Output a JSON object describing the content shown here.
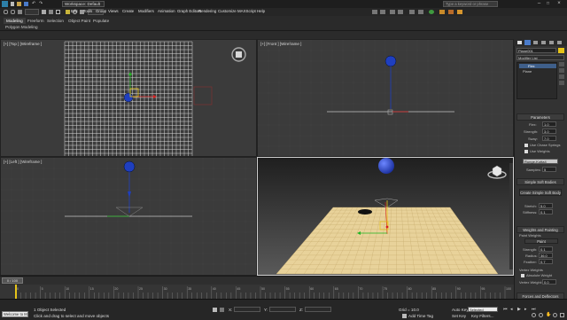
{
  "window": {
    "workspace": "Workspace: Default",
    "search_placeholder": "Type a keyword or phrase"
  },
  "menu": [
    "Edit",
    "Tools",
    "Group",
    "Views",
    "Create",
    "Modifiers",
    "Animation",
    "Graph Editors",
    "Rendering",
    "Customize",
    "MAXScript",
    "Help"
  ],
  "ribbon": {
    "tabs": [
      "Modeling",
      "Freeform",
      "Selection",
      "Object Paint",
      "Populate"
    ],
    "active_tab": "Modeling",
    "sub_label": "Polygon Modeling"
  },
  "viewports": {
    "top": "[+] [Top ] [Wireframe ]",
    "front": "[+] [Front ] [Wireframe ]",
    "left": "[+] [Left ] [Wireframe ]",
    "perspective": "[+] [Perspective ] [Realistic ]"
  },
  "command_panel": {
    "object_name": "Plane001",
    "modifier_list": "Modifier List",
    "stack": [
      "Flex",
      "Plane"
    ],
    "rollouts": {
      "parameters": "Parameters",
      "simple_soft_bodies": "Simple Soft Bodies",
      "create_simple_soft_body": "Create Simple Soft Body",
      "weights_painting": "Weights and Painting",
      "forces_deflectors": "Forces and Deflectors"
    },
    "params": {
      "flex_label": "Flex:",
      "flex_value": "1.0",
      "strength_label": "Strength:",
      "strength_value": "3.0",
      "sway_label": "Sway:",
      "sway_value": "7.0",
      "chase_springs": "Use Chase Springs",
      "use_weights": "Use Weights",
      "solver": "Runge-Kutta4",
      "samples_label": "Samples:",
      "samples_value": "5",
      "stretch_label": "Stretch:",
      "stretch_value": "5.0",
      "stiffness_label": "Stiffness:",
      "stiffness_value": "0.1",
      "paint_weights": "Paint Weights",
      "paint_label": "Paint",
      "p_strength_label": "Strength:",
      "p_strength_value": "0.1",
      "radius_label": "Radius:",
      "radius_value": "36.0",
      "feather_label": "Feather:",
      "feather_value": "0.7",
      "vertex_weights": "Vertex Weights",
      "absolute_weight": "Absolute Weight",
      "vertex_weight_label": "Vertex Weight:",
      "vertex_weight_value": "0.0"
    }
  },
  "timeline": {
    "frame_display": "0 / 100",
    "ticks": [
      "0",
      "5",
      "10",
      "15",
      "20",
      "25",
      "30",
      "35",
      "40",
      "45",
      "50",
      "55",
      "60",
      "65",
      "70",
      "75",
      "80",
      "85",
      "90",
      "95",
      "100"
    ]
  },
  "status": {
    "welcome": "Welcome to M",
    "selection": "1 Object Selected",
    "prompt": "Click and drag to select and move objects",
    "x_label": "X:",
    "y_label": "Y:",
    "z_label": "Z:",
    "grid": "Grid = 10.0",
    "add_time_tag": "Add Time Tag",
    "autokey": "Auto Key",
    "setkey": "Set Key",
    "key_filter": "Selected",
    "key_filters": "Key Filters..."
  },
  "colors": {
    "grid_white": "#d8d8d8",
    "plane_yellow": "#e8d29a",
    "sphere_blue": "#1f3fbf",
    "gizmo_yellow": "#e6c419",
    "axis_red": "#d81f1f",
    "axis_green": "#22b422"
  }
}
